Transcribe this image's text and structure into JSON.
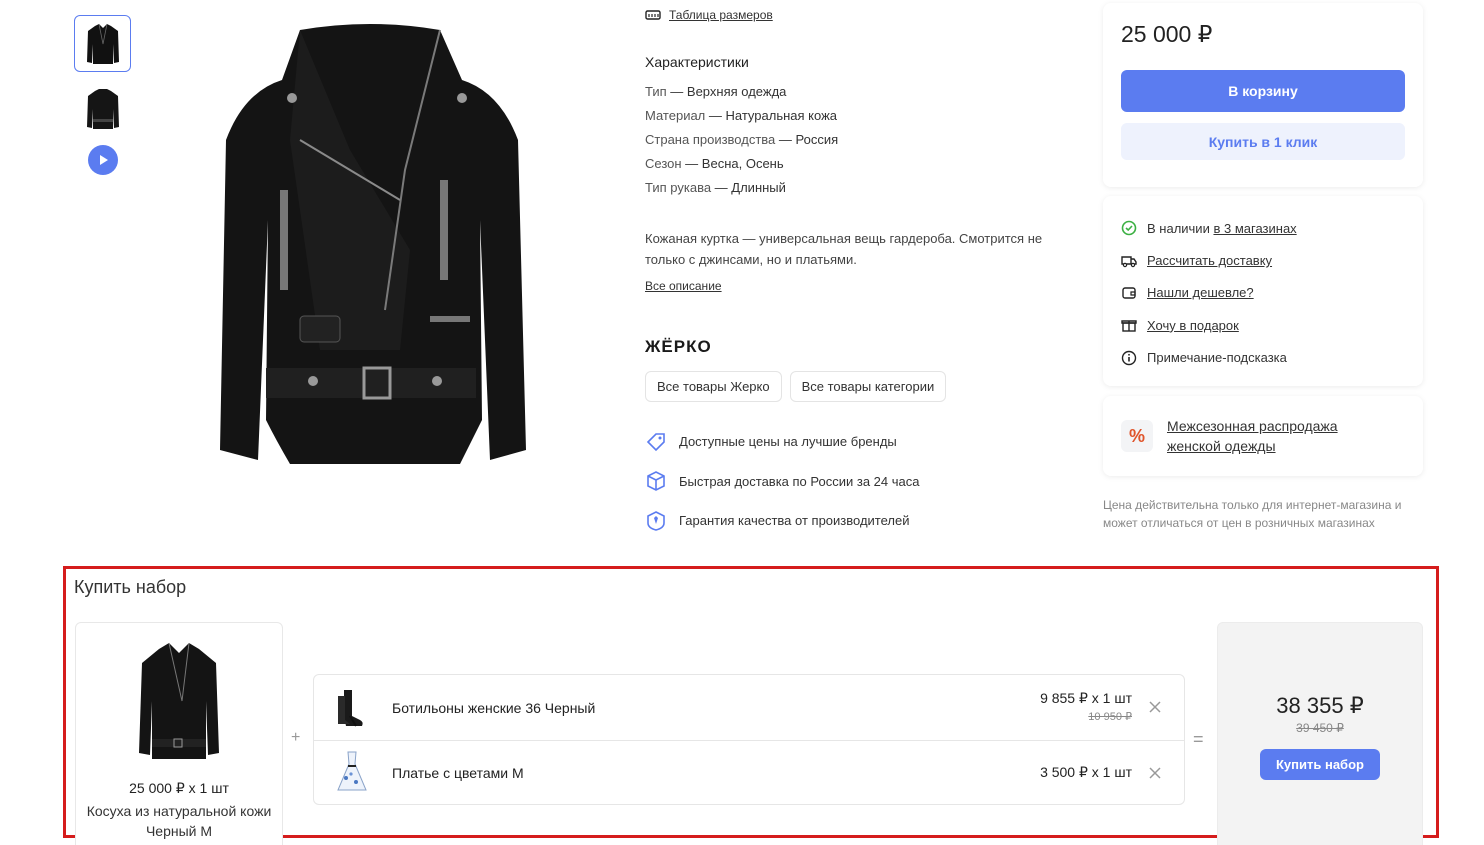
{
  "gallery": {
    "thumbnails": [
      "jacket-front",
      "jacket-back"
    ],
    "play_icon": "play-icon"
  },
  "info": {
    "size_table_link": "Таблица размеров",
    "chars_title": "Характеристики",
    "chars": [
      {
        "k": "Тип",
        "v": "Верхняя одежда"
      },
      {
        "k": "Материал",
        "v": "Натуральная кожа"
      },
      {
        "k": "Страна производства",
        "v": "Россия"
      },
      {
        "k": "Сезон",
        "v": "Весна, Осень"
      },
      {
        "k": "Тип рукава",
        "v": "Длинный"
      }
    ],
    "description": "Кожаная куртка — универсальная вещь гардероба. Смотрится не только с джинсами, но и платьями.",
    "all_description_link": "Все описание",
    "brand_logo": "ЖЁРКО",
    "brand_buttons": [
      "Все товары Жерко",
      "Все товары категории"
    ],
    "perks": [
      "Доступные цены на лучшие бренды",
      "Быстрая доставка по России за 24 часа",
      "Гарантия качества от производителей"
    ]
  },
  "buy": {
    "price": "25 000 ₽",
    "cart_button": "В корзину",
    "one_click_button": "Купить в 1 клик"
  },
  "availability": {
    "in_stock_prefix": "В наличии",
    "in_stock_link": "в 3 магазинах",
    "calc_delivery": "Рассчитать доставку",
    "found_cheaper": "Нашли дешевле?",
    "want_gift": "Хочу в подарок",
    "hint_note": "Примечание-подсказка"
  },
  "promo": {
    "text_line1": "Межсезонная распродажа",
    "text_line2": "женской одежды"
  },
  "price_note": "Цена действительна только для интернет-магазина и может отличаться от цен в розничных магазинах",
  "bundle": {
    "title": "Купить набор",
    "main_item": {
      "qty": "25 000 ₽ x 1 шт",
      "name": "Косуха из натуральной кожи Черный M"
    },
    "plus": "+",
    "equals": "=",
    "items": [
      {
        "name": "Ботильоны женские 36 Черный",
        "price": "9 855 ₽ x 1 шт",
        "old_price": "10 950 ₽"
      },
      {
        "name": "Платье с цветами M",
        "price": "3 500 ₽ x 1 шт",
        "old_price": ""
      }
    ],
    "total": "38 355 ₽",
    "total_old": "39 450 ₽",
    "buy_button": "Купить набор"
  },
  "colors": {
    "accent": "#5b7cf0",
    "highlight_border": "#d51c1c"
  }
}
